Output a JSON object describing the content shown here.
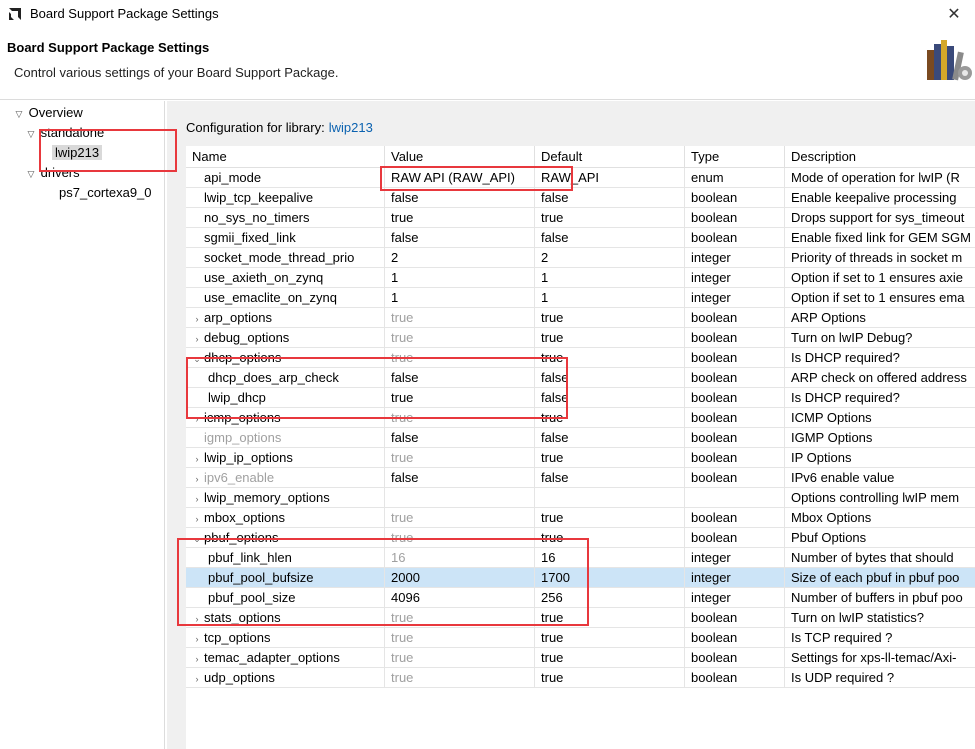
{
  "window": {
    "title": "Board Support Package Settings",
    "close_symbol": "✕"
  },
  "header": {
    "title": "Board Support Package Settings",
    "description": "Control various settings of your Board Support Package."
  },
  "tree": {
    "overview": "Overview",
    "standalone": "standalone",
    "lwip": "lwip213",
    "drivers": "drivers",
    "cpu": "ps7_cortexa9_0"
  },
  "config": {
    "label": "Configuration for library:",
    "library": "lwip213"
  },
  "table": {
    "headers": [
      "Name",
      "Value",
      "Default",
      "Type",
      "Description"
    ],
    "rows": [
      {
        "name": "api_mode",
        "value": "RAW API (RAW_API)",
        "default": "RAW_API",
        "type": "enum",
        "desc": "Mode of operation for lwIP (R"
      },
      {
        "name": "lwip_tcp_keepalive",
        "value": "false",
        "default": "false",
        "type": "boolean",
        "desc": "Enable keepalive processing"
      },
      {
        "name": "no_sys_no_timers",
        "value": "true",
        "default": "true",
        "type": "boolean",
        "desc": "Drops support for sys_timeout"
      },
      {
        "name": "sgmii_fixed_link",
        "value": "false",
        "default": "false",
        "type": "boolean",
        "desc": "Enable fixed link for GEM SGM"
      },
      {
        "name": "socket_mode_thread_prio",
        "value": "2",
        "default": "2",
        "type": "integer",
        "desc": "Priority of threads in socket m"
      },
      {
        "name": "use_axieth_on_zynq",
        "value": "1",
        "default": "1",
        "type": "integer",
        "desc": "Option if set to 1 ensures axie"
      },
      {
        "name": "use_emaclite_on_zynq",
        "value": "1",
        "default": "1",
        "type": "integer",
        "desc": "Option if set to 1 ensures ema"
      },
      {
        "name": "arp_options",
        "value": "true",
        "default": "true",
        "type": "boolean",
        "desc": "ARP Options"
      },
      {
        "name": "debug_options",
        "value": "true",
        "default": "true",
        "type": "boolean",
        "desc": "Turn on lwIP Debug?"
      },
      {
        "name": "dhcp_options",
        "value": "true",
        "default": "true",
        "type": "boolean",
        "desc": "Is DHCP required?"
      },
      {
        "name": "dhcp_does_arp_check",
        "value": "false",
        "default": "false",
        "type": "boolean",
        "desc": "ARP check on offered address"
      },
      {
        "name": "lwip_dhcp",
        "value": "true",
        "default": "false",
        "type": "boolean",
        "desc": "Is DHCP required?"
      },
      {
        "name": "icmp_options",
        "value": "true",
        "default": "true",
        "type": "boolean",
        "desc": "ICMP Options"
      },
      {
        "name": "igmp_options",
        "value": "false",
        "default": "false",
        "type": "boolean",
        "desc": "IGMP Options"
      },
      {
        "name": "lwip_ip_options",
        "value": "true",
        "default": "true",
        "type": "boolean",
        "desc": "IP Options"
      },
      {
        "name": "ipv6_enable",
        "value": "false",
        "default": "false",
        "type": "boolean",
        "desc": "IPv6 enable value"
      },
      {
        "name": "lwip_memory_options",
        "value": "",
        "default": "",
        "type": "",
        "desc": "Options controlling lwIP mem"
      },
      {
        "name": "mbox_options",
        "value": "true",
        "default": "true",
        "type": "boolean",
        "desc": "Mbox Options"
      },
      {
        "name": "pbuf_options",
        "value": "true",
        "default": "true",
        "type": "boolean",
        "desc": "Pbuf Options"
      },
      {
        "name": "pbuf_link_hlen",
        "value": "16",
        "default": "16",
        "type": "integer",
        "desc": "Number of bytes that should"
      },
      {
        "name": "pbuf_pool_bufsize",
        "value": "2000",
        "default": "1700",
        "type": "integer",
        "desc": "Size of each pbuf in pbuf poo"
      },
      {
        "name": "pbuf_pool_size",
        "value": "4096",
        "default": "256",
        "type": "integer",
        "desc": "Number of buffers in pbuf poo"
      },
      {
        "name": "stats_options",
        "value": "true",
        "default": "true",
        "type": "boolean",
        "desc": "Turn on lwIP statistics?"
      },
      {
        "name": "tcp_options",
        "value": "true",
        "default": "true",
        "type": "boolean",
        "desc": "Is TCP required ?"
      },
      {
        "name": "temac_adapter_options",
        "value": "true",
        "default": "true",
        "type": "boolean",
        "desc": "Settings for xps-ll-temac/Axi-"
      },
      {
        "name": "udp_options",
        "value": "true",
        "default": "true",
        "type": "boolean",
        "desc": "Is UDP required ?"
      }
    ]
  },
  "colors": {
    "annotation": "#e8383d",
    "selection": "#cce4f7",
    "link": "#0b62b0"
  }
}
